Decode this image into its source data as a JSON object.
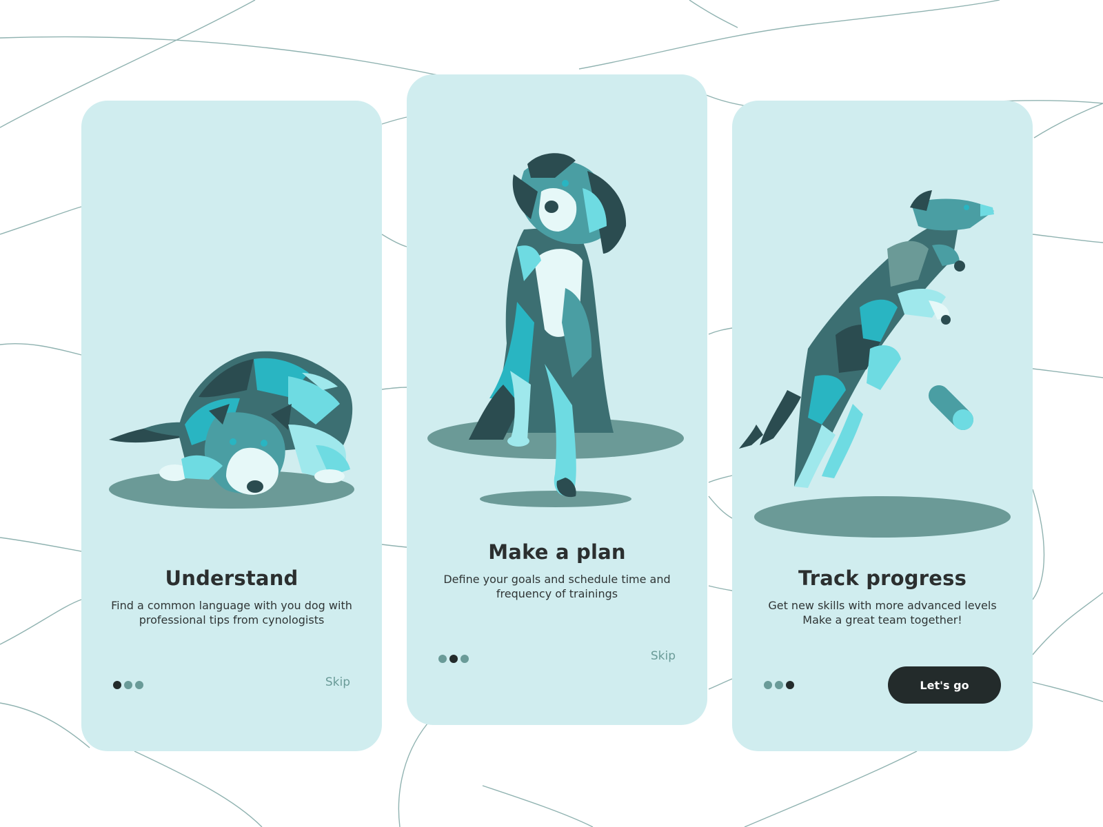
{
  "screens": [
    {
      "title": "Understand",
      "description_line1": "Find a common language with you dog with",
      "description_line2": "professional tips  from cynologists",
      "pagination_active": 1,
      "skip_label": "Skip",
      "illustration": "dog-lying-down-illustration"
    },
    {
      "title": "Make a plan",
      "description_line1": "Define your goals and schedule time and",
      "description_line2": "frequency of trainings",
      "pagination_active": 2,
      "skip_label": "Skip",
      "illustration": "dog-sitting-head-tilt-illustration"
    },
    {
      "title": "Track progress",
      "description_line1": "Get new skills with more advanced levels",
      "description_line2": "Make a great team together!",
      "pagination_active": 3,
      "cta_label": "Let's go",
      "illustration": "dog-jumping-for-toy-illustration"
    }
  ],
  "colors": {
    "card_background": "#d0edef",
    "accent_dark": "#232b2b",
    "muted_teal": "#6a9b98",
    "shadow": "#6b9a97",
    "dog_palette": [
      "#2b4c50",
      "#3c6f72",
      "#4a9ea3",
      "#29b5c2",
      "#6edbe2",
      "#9fe8ec",
      "#e6f8f8"
    ]
  }
}
